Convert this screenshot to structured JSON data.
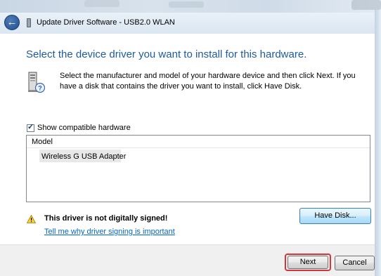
{
  "window": {
    "title": "Update Driver Software - USB2.0 WLAN",
    "back_icon": "back-arrow-icon",
    "device_icon": "usb-device-icon"
  },
  "main": {
    "heading": "Select the device driver you want to install for this hardware.",
    "instruction": "Select the manufacturer and model of your hardware device and then click Next. If you have a disk that contains the driver you want to install, click Have Disk.",
    "hardware_icon": "hardware-help-icon",
    "show_compatible": {
      "label": "Show compatible hardware",
      "checked": true
    },
    "model_list": {
      "header": "Model",
      "items": [
        "Wireless G USB Adapter"
      ],
      "selected_index": 0
    },
    "warning": {
      "icon": "warning-triangle-icon",
      "text": "This driver is not digitally signed!",
      "link": "Tell me why driver signing is important"
    },
    "have_disk_label": "Have Disk..."
  },
  "footer": {
    "next_label": "Next",
    "cancel_label": "Cancel"
  },
  "colors": {
    "heading": "#1e5b9a",
    "link": "#0066cc",
    "highlight": "#d6333a"
  }
}
